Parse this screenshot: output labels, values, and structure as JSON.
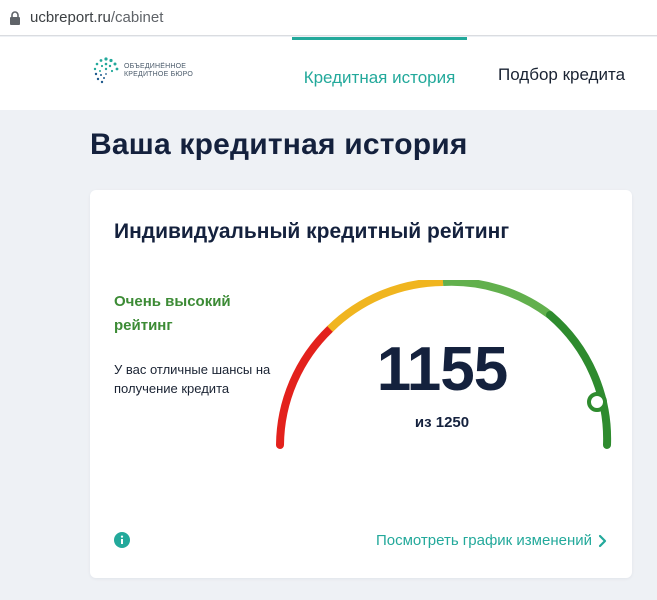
{
  "browser": {
    "url_domain": "ucbreport.ru",
    "url_path": "/cabinet"
  },
  "header": {
    "logo_line1": "ОБЪЕДИНЁННОЕ",
    "logo_line2": "КРЕДИТНОЕ БЮРО",
    "nav": [
      {
        "label": "Кредитная история",
        "active": true
      },
      {
        "label": "Подбор кредита",
        "active": false
      }
    ]
  },
  "page": {
    "title": "Ваша кредитная история"
  },
  "rating_card": {
    "title": "Индивидуальный кредитный рейтинг",
    "rating_label": "Очень высокий рейтинг",
    "description": "У вас отличные шансы на получение кредита",
    "score": 1155,
    "score_display": "1155",
    "max_display": "из 1250",
    "max": 1250,
    "gauge_colors": [
      "#e3211c",
      "#f0b51f",
      "#62b04d",
      "#2e8b2e"
    ],
    "accent": "#23a99b",
    "link_label": "Посмотреть график изменений",
    "icons": [
      "info-icon",
      "chevron-right-icon"
    ]
  }
}
